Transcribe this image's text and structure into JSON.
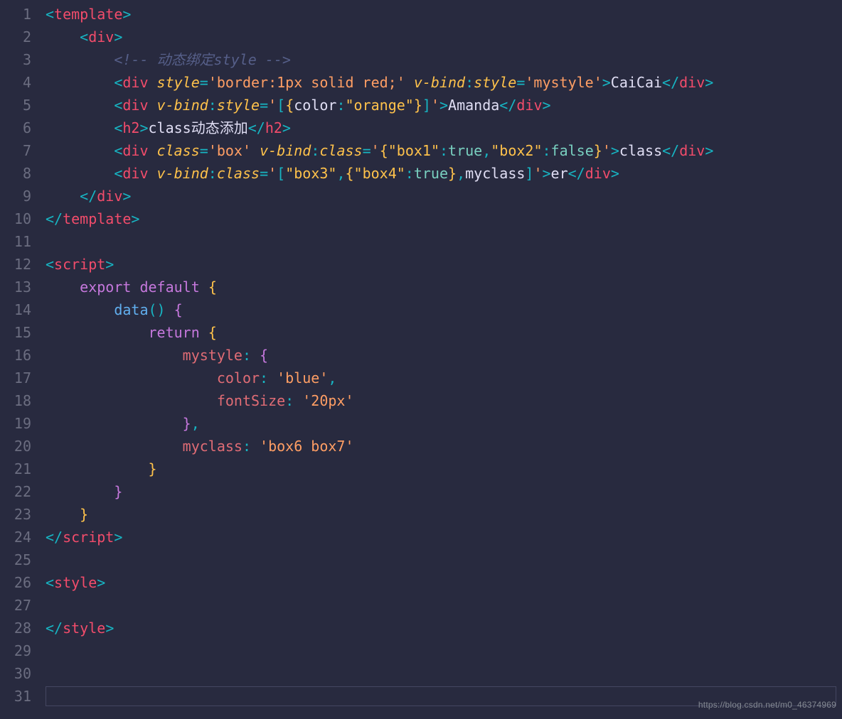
{
  "lineTotal": 31,
  "watermark": "https://blog.csdn.net/m0_46374969",
  "cursorTop": 966,
  "tokens": {
    "l1": [
      [
        "punct",
        "<"
      ],
      [
        "tag",
        "template"
      ],
      [
        "punct",
        ">"
      ]
    ],
    "l2": [
      [
        "ws",
        "    "
      ],
      [
        "punct",
        "<"
      ],
      [
        "tag",
        "div"
      ],
      [
        "punct",
        ">"
      ]
    ],
    "l3": [
      [
        "ws",
        "        "
      ],
      [
        "comment",
        "<!-- 动态绑定style -->"
      ]
    ],
    "l4": [
      [
        "ws",
        "        "
      ],
      [
        "punct",
        "<"
      ],
      [
        "tag",
        "div"
      ],
      [
        "ws",
        " "
      ],
      [
        "attr",
        "style"
      ],
      [
        "punct",
        "="
      ],
      [
        "str",
        "'border:1px solid red;'"
      ],
      [
        "ws",
        " "
      ],
      [
        "vdir",
        "v-bind"
      ],
      [
        "punct",
        ":"
      ],
      [
        "vdirkey",
        "style"
      ],
      [
        "punct",
        "="
      ],
      [
        "str",
        "'mystyle'"
      ],
      [
        "punct",
        ">"
      ],
      [
        "text",
        "CaiCai"
      ],
      [
        "punct",
        "</"
      ],
      [
        "tag",
        "div"
      ],
      [
        "punct",
        ">"
      ]
    ],
    "l5": [
      [
        "ws",
        "        "
      ],
      [
        "punct",
        "<"
      ],
      [
        "tag",
        "div"
      ],
      [
        "ws",
        " "
      ],
      [
        "vdir",
        "v-bind"
      ],
      [
        "punct",
        ":"
      ],
      [
        "vdirkey",
        "style"
      ],
      [
        "punct",
        "="
      ],
      [
        "str",
        "'"
      ],
      [
        "punct",
        "["
      ],
      [
        "brkt",
        "{"
      ],
      [
        "ident",
        "color"
      ],
      [
        "punct",
        ":"
      ],
      [
        "strin",
        "\"orange\""
      ],
      [
        "brkt",
        "}"
      ],
      [
        "punct",
        "]"
      ],
      [
        "str",
        "'"
      ],
      [
        "punct",
        ">"
      ],
      [
        "text",
        "Amanda"
      ],
      [
        "punct",
        "</"
      ],
      [
        "tag",
        "div"
      ],
      [
        "punct",
        ">"
      ]
    ],
    "l6": [
      [
        "ws",
        "        "
      ],
      [
        "punct",
        "<"
      ],
      [
        "tag",
        "h2"
      ],
      [
        "punct",
        ">"
      ],
      [
        "text",
        "class动态添加"
      ],
      [
        "punct",
        "</"
      ],
      [
        "tag",
        "h2"
      ],
      [
        "punct",
        ">"
      ]
    ],
    "l7": [
      [
        "ws",
        "        "
      ],
      [
        "punct",
        "<"
      ],
      [
        "tag",
        "div"
      ],
      [
        "ws",
        " "
      ],
      [
        "attr",
        "class"
      ],
      [
        "punct",
        "="
      ],
      [
        "str",
        "'box'"
      ],
      [
        "ws",
        " "
      ],
      [
        "vdir",
        "v-bind"
      ],
      [
        "punct",
        ":"
      ],
      [
        "vdirkey",
        "class"
      ],
      [
        "punct",
        "="
      ],
      [
        "str",
        "'"
      ],
      [
        "brkt",
        "{"
      ],
      [
        "strin",
        "\"box1\""
      ],
      [
        "punct",
        ":"
      ],
      [
        "kw2",
        "true"
      ],
      [
        "punct",
        ","
      ],
      [
        "strin",
        "\"box2\""
      ],
      [
        "punct",
        ":"
      ],
      [
        "kw2",
        "false"
      ],
      [
        "brkt",
        "}"
      ],
      [
        "str",
        "'"
      ],
      [
        "punct",
        ">"
      ],
      [
        "text",
        "class"
      ],
      [
        "punct",
        "</"
      ],
      [
        "tag",
        "div"
      ],
      [
        "punct",
        ">"
      ]
    ],
    "l8": [
      [
        "ws",
        "        "
      ],
      [
        "punct",
        "<"
      ],
      [
        "tag",
        "div"
      ],
      [
        "ws",
        " "
      ],
      [
        "vdir",
        "v-bind"
      ],
      [
        "punct",
        ":"
      ],
      [
        "vdirkey",
        "class"
      ],
      [
        "punct",
        "="
      ],
      [
        "str",
        "'"
      ],
      [
        "punct",
        "["
      ],
      [
        "strin",
        "\"box3\""
      ],
      [
        "punct",
        ","
      ],
      [
        "brkt",
        "{"
      ],
      [
        "strin",
        "\"box4\""
      ],
      [
        "punct",
        ":"
      ],
      [
        "kw2",
        "true"
      ],
      [
        "brkt",
        "}"
      ],
      [
        "punct",
        ","
      ],
      [
        "ident",
        "myclass"
      ],
      [
        "punct",
        "]"
      ],
      [
        "str",
        "'"
      ],
      [
        "punct",
        ">"
      ],
      [
        "text",
        "er"
      ],
      [
        "punct",
        "</"
      ],
      [
        "tag",
        "div"
      ],
      [
        "punct",
        ">"
      ]
    ],
    "l9": [
      [
        "ws",
        "    "
      ],
      [
        "punct",
        "</"
      ],
      [
        "tag",
        "div"
      ],
      [
        "punct",
        ">"
      ]
    ],
    "l10": [
      [
        "punct",
        "</"
      ],
      [
        "tag",
        "template"
      ],
      [
        "punct",
        ">"
      ]
    ],
    "l11": [],
    "l12": [
      [
        "punct",
        "<"
      ],
      [
        "tag",
        "script"
      ],
      [
        "punct",
        ">"
      ]
    ],
    "l13": [
      [
        "ws",
        "    "
      ],
      [
        "keyw",
        "export"
      ],
      [
        "ws",
        " "
      ],
      [
        "keyw",
        "default"
      ],
      [
        "ws",
        " "
      ],
      [
        "brkt",
        "{"
      ]
    ],
    "l14": [
      [
        "ws",
        "        "
      ],
      [
        "fn",
        "data"
      ],
      [
        "punct",
        "()"
      ],
      [
        "ws",
        " "
      ],
      [
        "brkt2",
        "{"
      ]
    ],
    "l15": [
      [
        "ws",
        "            "
      ],
      [
        "keyw",
        "return"
      ],
      [
        "ws",
        " "
      ],
      [
        "brkt",
        "{"
      ]
    ],
    "l16": [
      [
        "ws",
        "                "
      ],
      [
        "prop",
        "mystyle"
      ],
      [
        "punct",
        ":"
      ],
      [
        "ws",
        " "
      ],
      [
        "brkt2",
        "{"
      ]
    ],
    "l17": [
      [
        "ws",
        "                    "
      ],
      [
        "prop",
        "color"
      ],
      [
        "punct",
        ":"
      ],
      [
        "ws",
        " "
      ],
      [
        "val",
        "'blue'"
      ],
      [
        "punct",
        ","
      ]
    ],
    "l18": [
      [
        "ws",
        "                    "
      ],
      [
        "prop",
        "fontSize"
      ],
      [
        "punct",
        ":"
      ],
      [
        "ws",
        " "
      ],
      [
        "val",
        "'20px'"
      ]
    ],
    "l19": [
      [
        "ws",
        "                "
      ],
      [
        "brkt2",
        "}"
      ],
      [
        "punct",
        ","
      ]
    ],
    "l20": [
      [
        "ws",
        "                "
      ],
      [
        "prop",
        "myclass"
      ],
      [
        "punct",
        ":"
      ],
      [
        "ws",
        " "
      ],
      [
        "val",
        "'box6 box7'"
      ]
    ],
    "l21": [
      [
        "ws",
        "            "
      ],
      [
        "brkt",
        "}"
      ]
    ],
    "l22": [
      [
        "ws",
        "        "
      ],
      [
        "brkt2",
        "}"
      ]
    ],
    "l23": [
      [
        "ws",
        "    "
      ],
      [
        "brkt",
        "}"
      ]
    ],
    "l24": [
      [
        "punct",
        "</"
      ],
      [
        "tag",
        "script"
      ],
      [
        "punct",
        ">"
      ]
    ],
    "l25": [],
    "l26": [
      [
        "punct",
        "<"
      ],
      [
        "tag",
        "style"
      ],
      [
        "punct",
        ">"
      ]
    ],
    "l27": [],
    "l28": [
      [
        "punct",
        "</"
      ],
      [
        "tag",
        "style"
      ],
      [
        "punct",
        ">"
      ]
    ],
    "l29": [],
    "l30": [],
    "l31": []
  }
}
